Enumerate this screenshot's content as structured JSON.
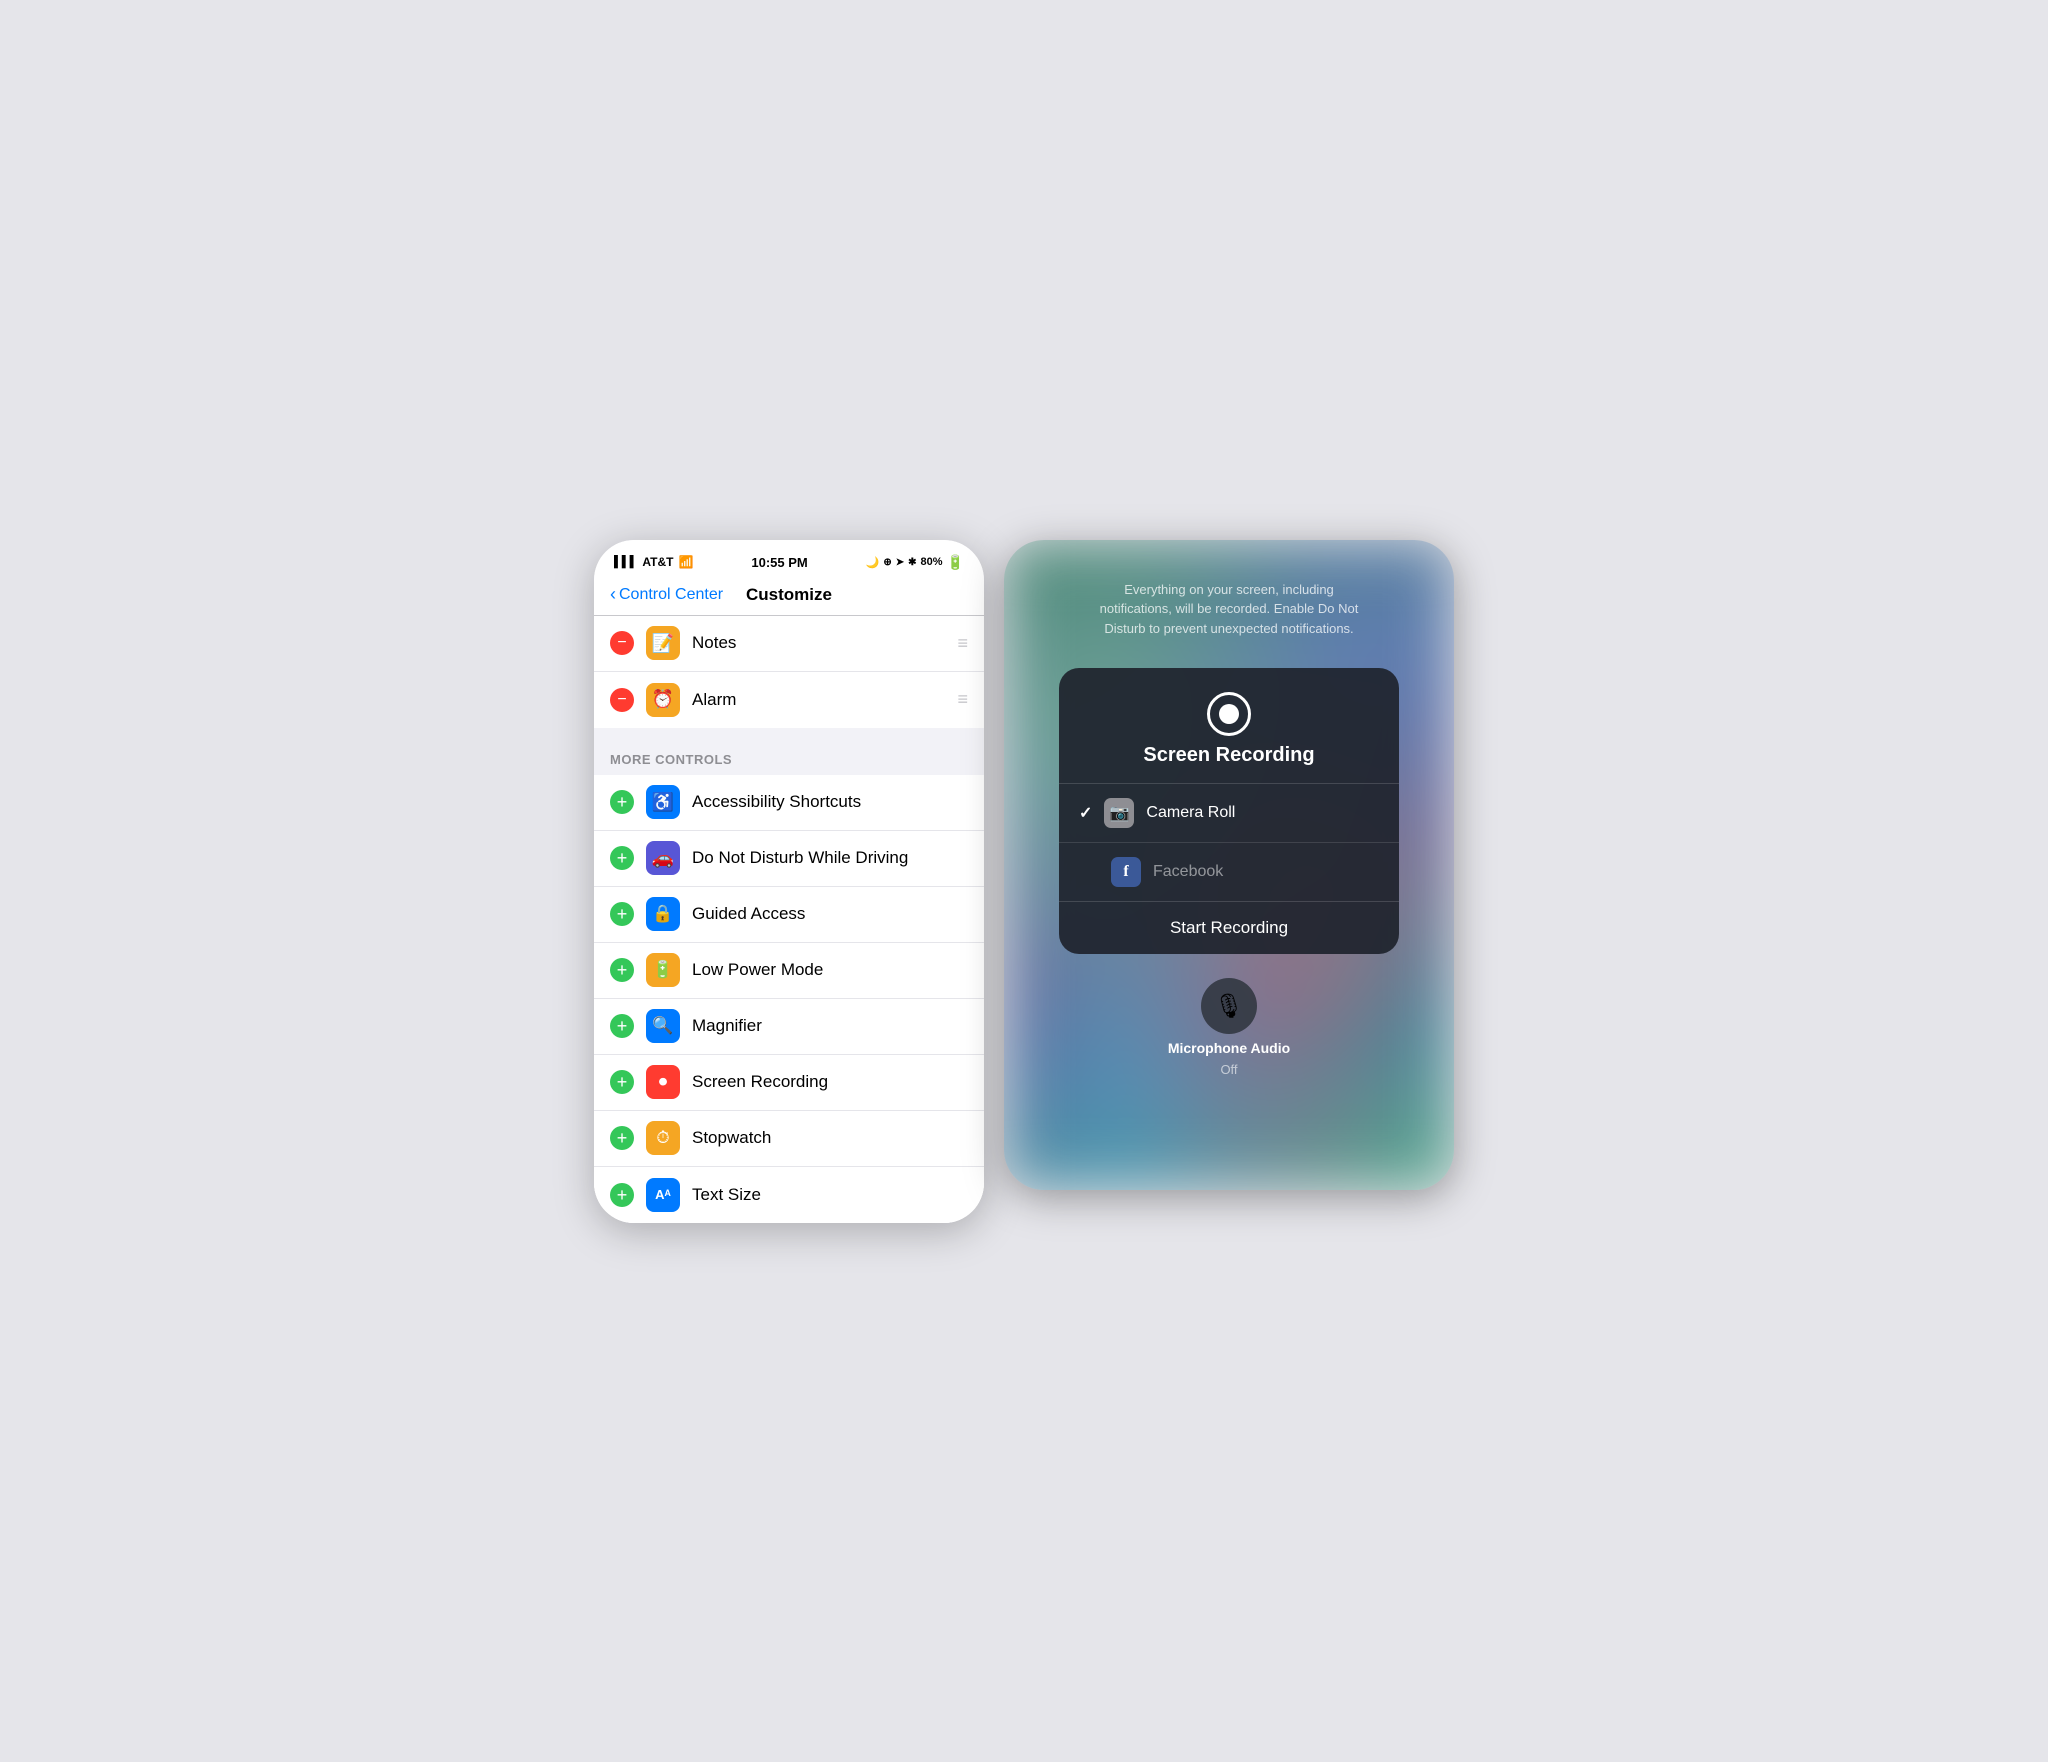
{
  "left_panel": {
    "status_bar": {
      "carrier": "AT&T",
      "time": "10:55 PM",
      "battery": "80%"
    },
    "nav": {
      "back_label": "Control Center",
      "title": "Customize"
    },
    "included_items": [
      {
        "id": "notes",
        "label": "Notes",
        "icon_bg": "#f5a623",
        "icon_char": "📝",
        "action": "minus"
      },
      {
        "id": "alarm",
        "label": "Alarm",
        "icon_bg": "#f5a623",
        "icon_char": "⏰",
        "action": "minus"
      }
    ],
    "more_controls_header": "MORE CONTROLS",
    "more_controls": [
      {
        "id": "accessibility-shortcuts",
        "label": "Accessibility Shortcuts",
        "icon_bg": "#007aff",
        "icon_char": "♿"
      },
      {
        "id": "do-not-disturb-driving",
        "label": "Do Not Disturb While Driving",
        "icon_bg": "#5856d6",
        "icon_char": "🚗"
      },
      {
        "id": "guided-access",
        "label": "Guided Access",
        "icon_bg": "#007aff",
        "icon_char": "🔒"
      },
      {
        "id": "low-power-mode",
        "label": "Low Power Mode",
        "icon_bg": "#f5a623",
        "icon_char": "🔋"
      },
      {
        "id": "magnifier",
        "label": "Magnifier",
        "icon_bg": "#007aff",
        "icon_char": "🔍"
      },
      {
        "id": "screen-recording",
        "label": "Screen Recording",
        "icon_bg": "#ff3b30",
        "icon_char": "⏺"
      },
      {
        "id": "stopwatch",
        "label": "Stopwatch",
        "icon_bg": "#f5a623",
        "icon_char": "⏱"
      },
      {
        "id": "text-size",
        "label": "Text Size",
        "icon_bg": "#007aff",
        "icon_char": "Aᴬ"
      }
    ]
  },
  "right_panel": {
    "notice_text": "Everything on your screen, including notifications, will be recorded. Enable Do Not Disturb to prevent unexpected notifications.",
    "popup": {
      "title": "Screen Recording",
      "options": [
        {
          "id": "camera-roll",
          "label": "Camera Roll",
          "icon_bg": "#8e8e93",
          "icon_char": "📷",
          "checked": true
        },
        {
          "id": "facebook",
          "label": "Facebook",
          "icon_bg": "#3b5998",
          "icon_char": "f",
          "checked": false
        }
      ],
      "start_recording_label": "Start Recording"
    },
    "mic": {
      "label": "Microphone Audio",
      "sublabel": "Off"
    }
  }
}
